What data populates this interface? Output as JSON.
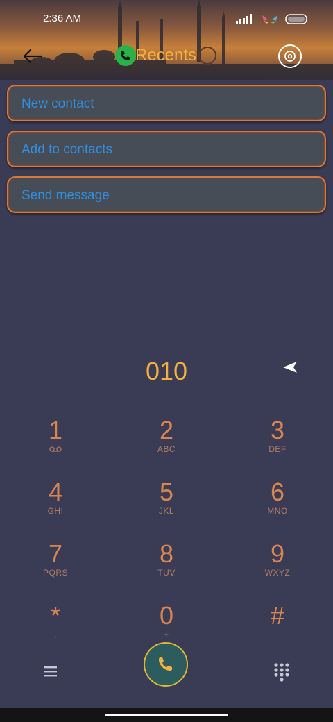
{
  "status_bar": {
    "time": "2:36 AM"
  },
  "header": {
    "title": "Recents"
  },
  "actions": [
    {
      "label": "New contact"
    },
    {
      "label": "Add to contacts"
    },
    {
      "label": "Send message"
    }
  ],
  "dialer": {
    "number": "010",
    "keys": [
      {
        "digit": "1",
        "letters": ""
      },
      {
        "digit": "2",
        "letters": "ABC"
      },
      {
        "digit": "3",
        "letters": "DEF"
      },
      {
        "digit": "4",
        "letters": "GHI"
      },
      {
        "digit": "5",
        "letters": "JKL"
      },
      {
        "digit": "6",
        "letters": "MNO"
      },
      {
        "digit": "7",
        "letters": "PQRS"
      },
      {
        "digit": "8",
        "letters": "TUV"
      },
      {
        "digit": "9",
        "letters": "WXYZ"
      },
      {
        "digit": "*",
        "letters": ","
      },
      {
        "digit": "0",
        "letters": "+"
      },
      {
        "digit": "#",
        "letters": ""
      }
    ]
  },
  "colors": {
    "accent": "#f4b03e",
    "link": "#2f8ee0",
    "key_digit": "#d88550",
    "background": "#3a3b55",
    "call_button_ring": "#e0b63a"
  },
  "icons": {
    "back": "back-arrow-icon",
    "title_phone": "phone-icon",
    "title_clock": "clock-icon",
    "settings": "gear-icon",
    "delete": "backspace-icon",
    "voicemail": "voicemail-icon",
    "menu": "menu-icon",
    "call": "phone-icon",
    "dialpad": "dialpad-icon"
  }
}
